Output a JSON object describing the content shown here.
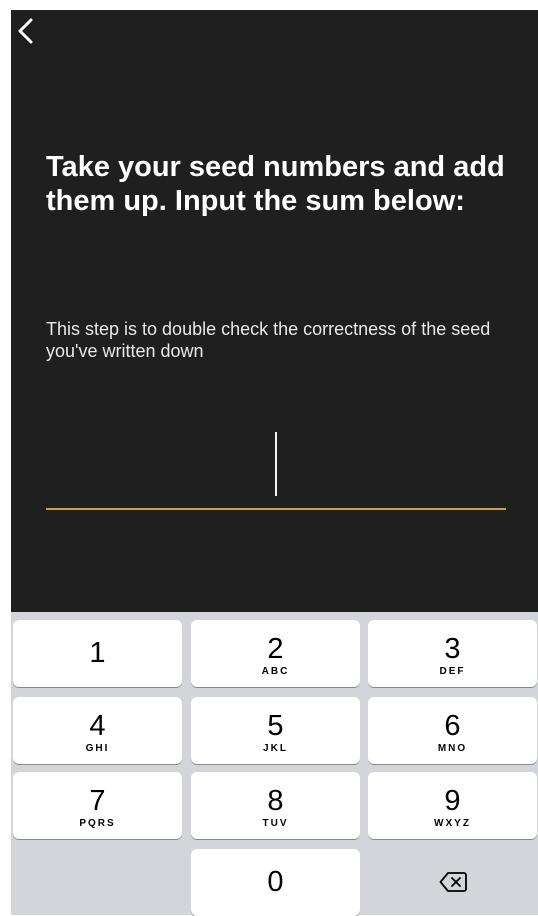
{
  "navigation": {
    "back_icon": "chevron-left-icon"
  },
  "content": {
    "heading": "Take your seed numbers and add them up. Input the sum below:",
    "description": "This step is to double check the correctness of the seed you've written down",
    "sum_input_value": "",
    "accent_color": "#c9a24a",
    "background_color": "#1f1f1f"
  },
  "keypad": {
    "keys": [
      {
        "digit": "1",
        "letters": ""
      },
      {
        "digit": "2",
        "letters": "ABC"
      },
      {
        "digit": "3",
        "letters": "DEF"
      },
      {
        "digit": "4",
        "letters": "GHI"
      },
      {
        "digit": "5",
        "letters": "JKL"
      },
      {
        "digit": "6",
        "letters": "MNO"
      },
      {
        "digit": "7",
        "letters": "PQRS"
      },
      {
        "digit": "8",
        "letters": "TUV"
      },
      {
        "digit": "9",
        "letters": "WXYZ"
      },
      {
        "digit": "0",
        "letters": ""
      }
    ],
    "delete_icon": "backspace-icon"
  }
}
